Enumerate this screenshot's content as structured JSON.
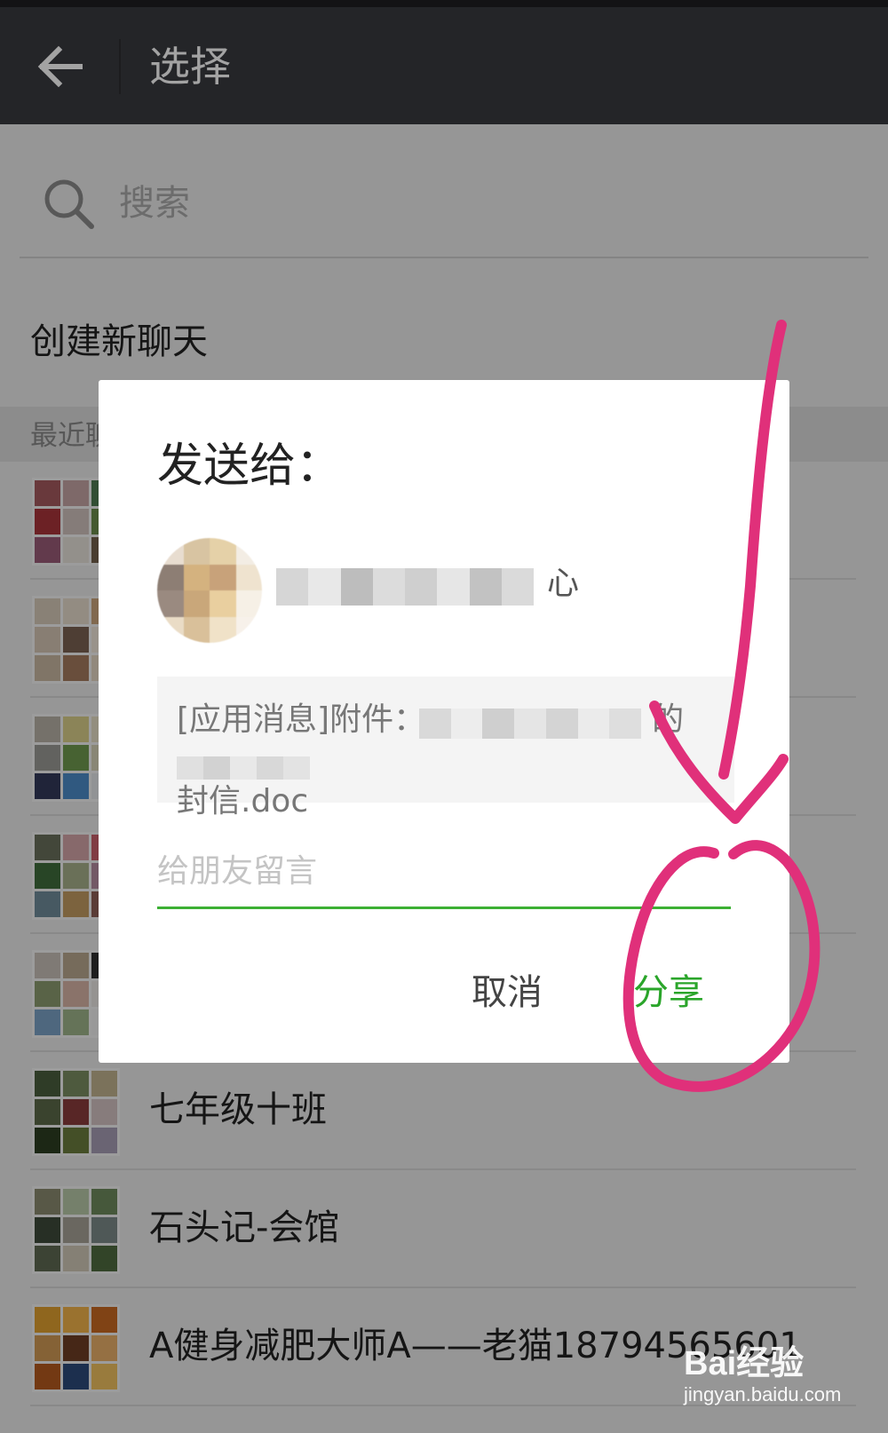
{
  "header": {
    "title": "选择"
  },
  "search": {
    "placeholder": "搜索"
  },
  "new_chat_label": "创建新聊天",
  "section_label": "最近聊天",
  "chats": [
    {
      "name": "",
      "avatar": [
        "#a45a5e",
        "#c6a5a4",
        "#4f7a52",
        "#a9343b",
        "#d1c3be",
        "#6b8c4c",
        "#9a5b78",
        "#e6e2da",
        "#72604c"
      ]
    },
    {
      "name": "",
      "avatar": [
        "#d7cab9",
        "#e7dccb",
        "#caa57c",
        "#d5c6b5",
        "#7b6152",
        "#f0e6da",
        "#c8b7a2",
        "#a57a5e",
        "#e4d6c3"
      ]
    },
    {
      "name": "",
      "avatar": [
        "#b7b1a6",
        "#d9cf8a",
        "#e6dfc6",
        "#9a9a95",
        "#6f9a4f",
        "#d7d2b7",
        "#33395a",
        "#4b8cc8",
        "#e3e7ea"
      ]
    },
    {
      "name": "",
      "avatar": [
        "#69705c",
        "#d4a5a8",
        "#c85e6a",
        "#3f6d3c",
        "#a6b08a",
        "#b58ca0",
        "#6f8b99",
        "#c39b62",
        "#8d5f55"
      ]
    },
    {
      "name": "",
      "avatar": [
        "#c7bfb7",
        "#b9a88f",
        "#303030",
        "#8c9b6f",
        "#d8b4a6",
        "#e9e6e3",
        "#7ba1c5",
        "#9fb58a",
        "#f0f0f0"
      ]
    },
    {
      "name": "七年级十班",
      "avatar": [
        "#4a5f3d",
        "#7a8e62",
        "#c0b28f",
        "#5b6a48",
        "#8a3c3c",
        "#d4c3c3",
        "#2d3d22",
        "#6b7c3e",
        "#a79db5"
      ]
    },
    {
      "name": "石头记-会馆",
      "avatar": [
        "#8a8a70",
        "#b7c8a8",
        "#6e8a5d",
        "#3d4a3a",
        "#a7a297",
        "#7c8a88",
        "#5e6a52",
        "#d0c9b8",
        "#4f6b3f"
      ]
    },
    {
      "name": "A健身减肥大师A——老猫18794565601",
      "avatar": [
        "#e0a030",
        "#f1b34a",
        "#c86a22",
        "#d09a55",
        "#6e3d25",
        "#eab069",
        "#b45a1f",
        "#2d4a7a",
        "#f0c060"
      ]
    }
  ],
  "dialog": {
    "title": "发送给：",
    "recipient_name_suffix": "心",
    "message_prefix": "[应用消息]附件：",
    "message_fragment_1": "的一",
    "message_fragment_2": "封信.doc",
    "comment_placeholder": "给朋友留言",
    "cancel_label": "取消",
    "share_label": "分享"
  },
  "watermark": {
    "logo": "Bai经验",
    "url": "jingyan.baidu.com"
  },
  "colors": {
    "header_bg": "#393a3f",
    "accent_green": "#2aa52a",
    "annotation_pink": "#e0307a"
  }
}
